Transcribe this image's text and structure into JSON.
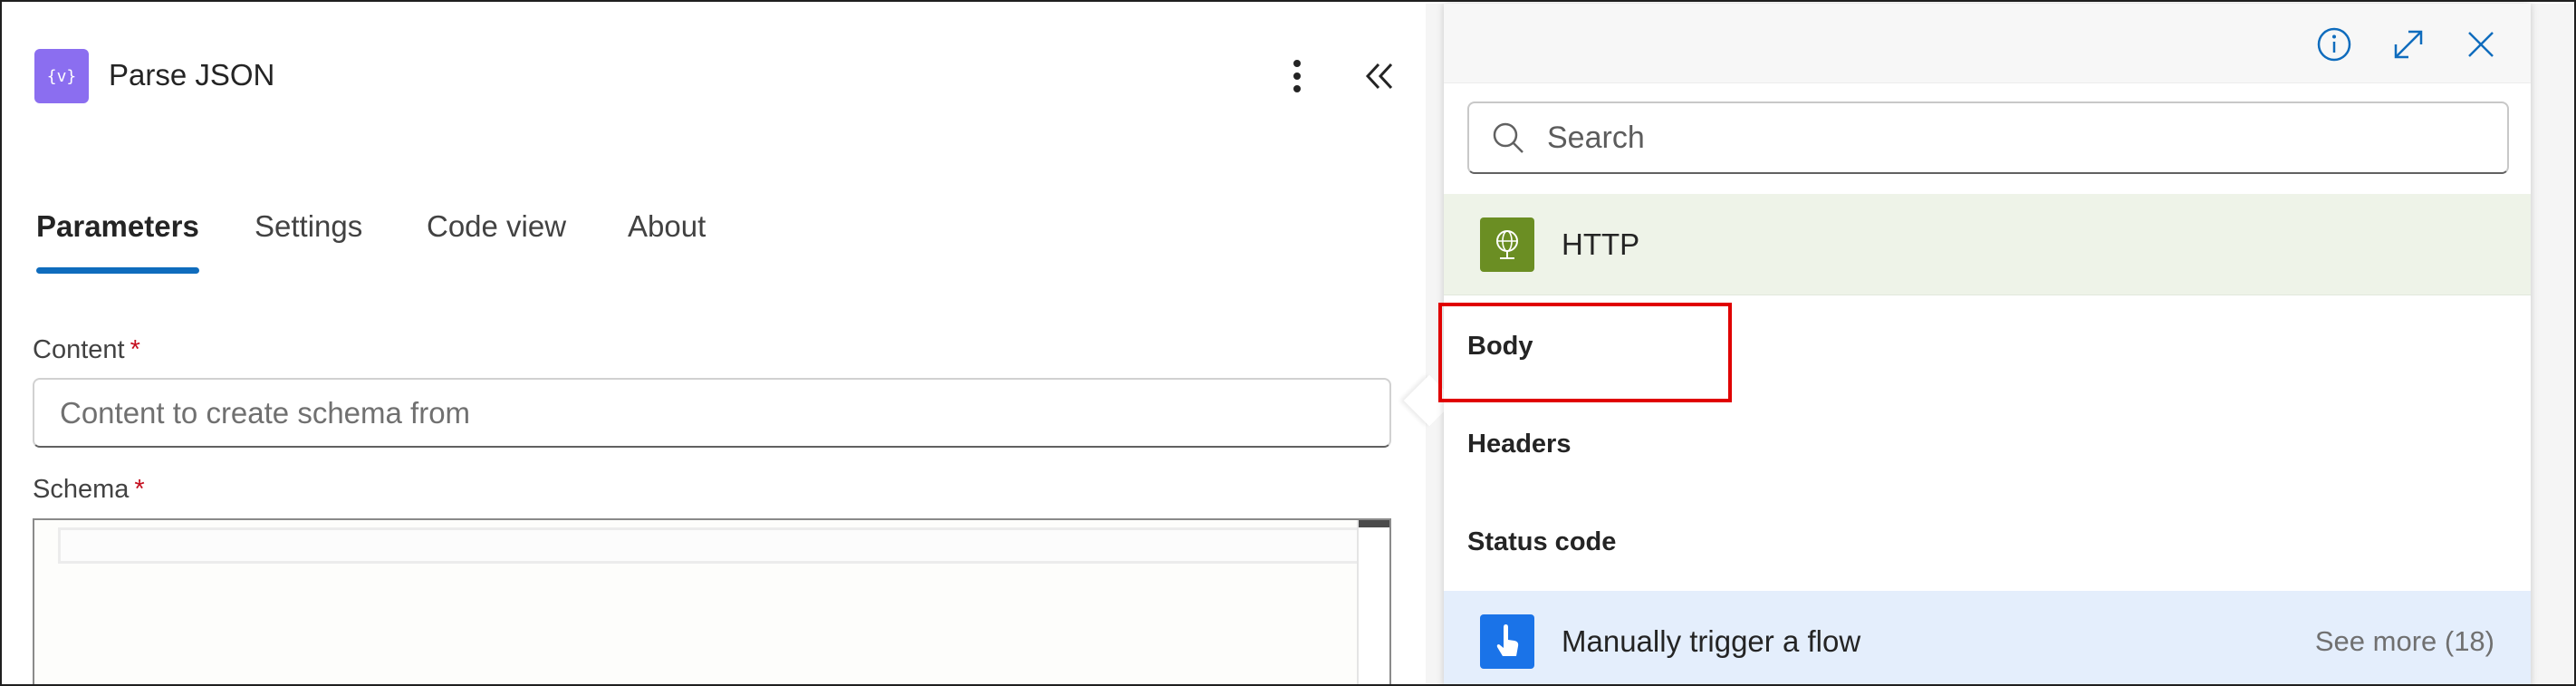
{
  "action": {
    "title": "Parse JSON",
    "icon": "braces-variable-icon",
    "icon_color": "#8b6ef0"
  },
  "tabs": [
    {
      "label": "Parameters",
      "active": true
    },
    {
      "label": "Settings",
      "active": false
    },
    {
      "label": "Code view",
      "active": false
    },
    {
      "label": "About",
      "active": false
    }
  ],
  "fields": {
    "content": {
      "label": "Content",
      "required_marker": "*",
      "placeholder": "Content to create schema from",
      "value": ""
    },
    "schema": {
      "label": "Schema",
      "required_marker": "*"
    }
  },
  "picker": {
    "search_placeholder": "Search",
    "groups": [
      {
        "name": "HTTP",
        "icon": "globe-icon",
        "icon_color": "#6b8e23",
        "tokens": [
          "Body",
          "Headers",
          "Status code"
        ]
      },
      {
        "name": "Manually trigger a flow",
        "icon": "touch-hand-icon",
        "icon_color": "#1a73e8",
        "see_more": "See more (18)"
      }
    ],
    "highlighted_token": "Body"
  },
  "colors": {
    "accent": "#0f6cbd",
    "required": "#c50f1f",
    "highlight": "#e00000",
    "http_group_bg": "#eef3e8",
    "manual_group_bg": "#e4eefc"
  }
}
